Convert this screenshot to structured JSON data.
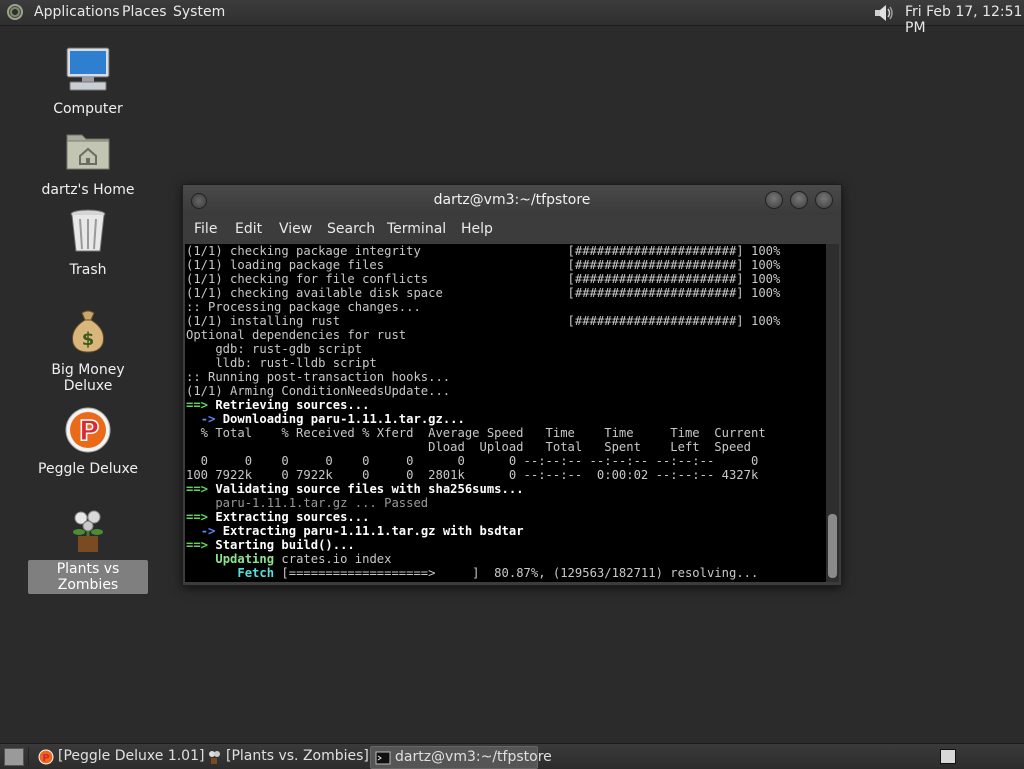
{
  "top_panel": {
    "menus": [
      "Applications",
      "Places",
      "System"
    ],
    "clock": "Fri Feb 17, 12:51 PM"
  },
  "desktop": {
    "icons": [
      {
        "label": "Computer",
        "icon": "computer-icon"
      },
      {
        "label": "dartz's Home",
        "icon": "home-folder-icon"
      },
      {
        "label": "Trash",
        "icon": "trash-icon"
      },
      {
        "label": "Big Money Deluxe",
        "icon": "money-bag-icon"
      },
      {
        "label": "Peggle Deluxe",
        "icon": "peggle-icon"
      },
      {
        "label": "Plants vs Zombies",
        "icon": "plants-vs-zombies-icon",
        "selected": true
      }
    ]
  },
  "terminal_window": {
    "title": "dartz@vm3:~/tfpstore",
    "menu": [
      "File",
      "Edit",
      "View",
      "Search",
      "Terminal",
      "Help"
    ],
    "lines": [
      "(1/1) checking package integrity                    [######################] 100%",
      "(1/1) loading package files                         [######################] 100%",
      "(1/1) checking for file conflicts                   [######################] 100%",
      "(1/1) checking available disk space                 [######################] 100%",
      ":: Processing package changes...",
      "(1/1) installing rust                               [######################] 100%",
      "Optional dependencies for rust",
      "    gdb: rust-gdb script",
      "    lldb: rust-lldb script",
      ":: Running post-transaction hooks...",
      "(1/1) Arming ConditionNeedsUpdate...",
      "==> Retrieving sources...",
      "  -> Downloading paru-1.11.1.tar.gz...",
      "  % Total    % Received % Xferd  Average Speed   Time    Time     Time  Current",
      "                                 Dload  Upload   Total   Spent    Left  Speed",
      "  0     0    0     0    0     0      0      0 --:--:-- --:--:-- --:--:--     0",
      "100 7922k    0 7922k    0     0  2801k      0 --:--:--  0:00:02 --:--:-- 4327k",
      "==> Validating source files with sha256sums...",
      "    paru-1.11.1.tar.gz ... Passed",
      "==> Extracting sources...",
      "  -> Extracting paru-1.11.1.tar.gz with bsdtar",
      "==> Starting build()...",
      "    Updating crates.io index",
      "       Fetch [===================>     ]  80.87%, (129563/182711) resolving..."
    ]
  },
  "taskbar": {
    "tasks": [
      {
        "label": "[Peggle Deluxe 1.01]",
        "icon": "peggle-icon",
        "active": false
      },
      {
        "label": "[Plants vs. Zombies]",
        "icon": "plants-vs-zombies-icon",
        "active": false
      },
      {
        "label": "dartz@vm3:~/tfpstore",
        "icon": "terminal-icon",
        "active": true
      }
    ]
  }
}
